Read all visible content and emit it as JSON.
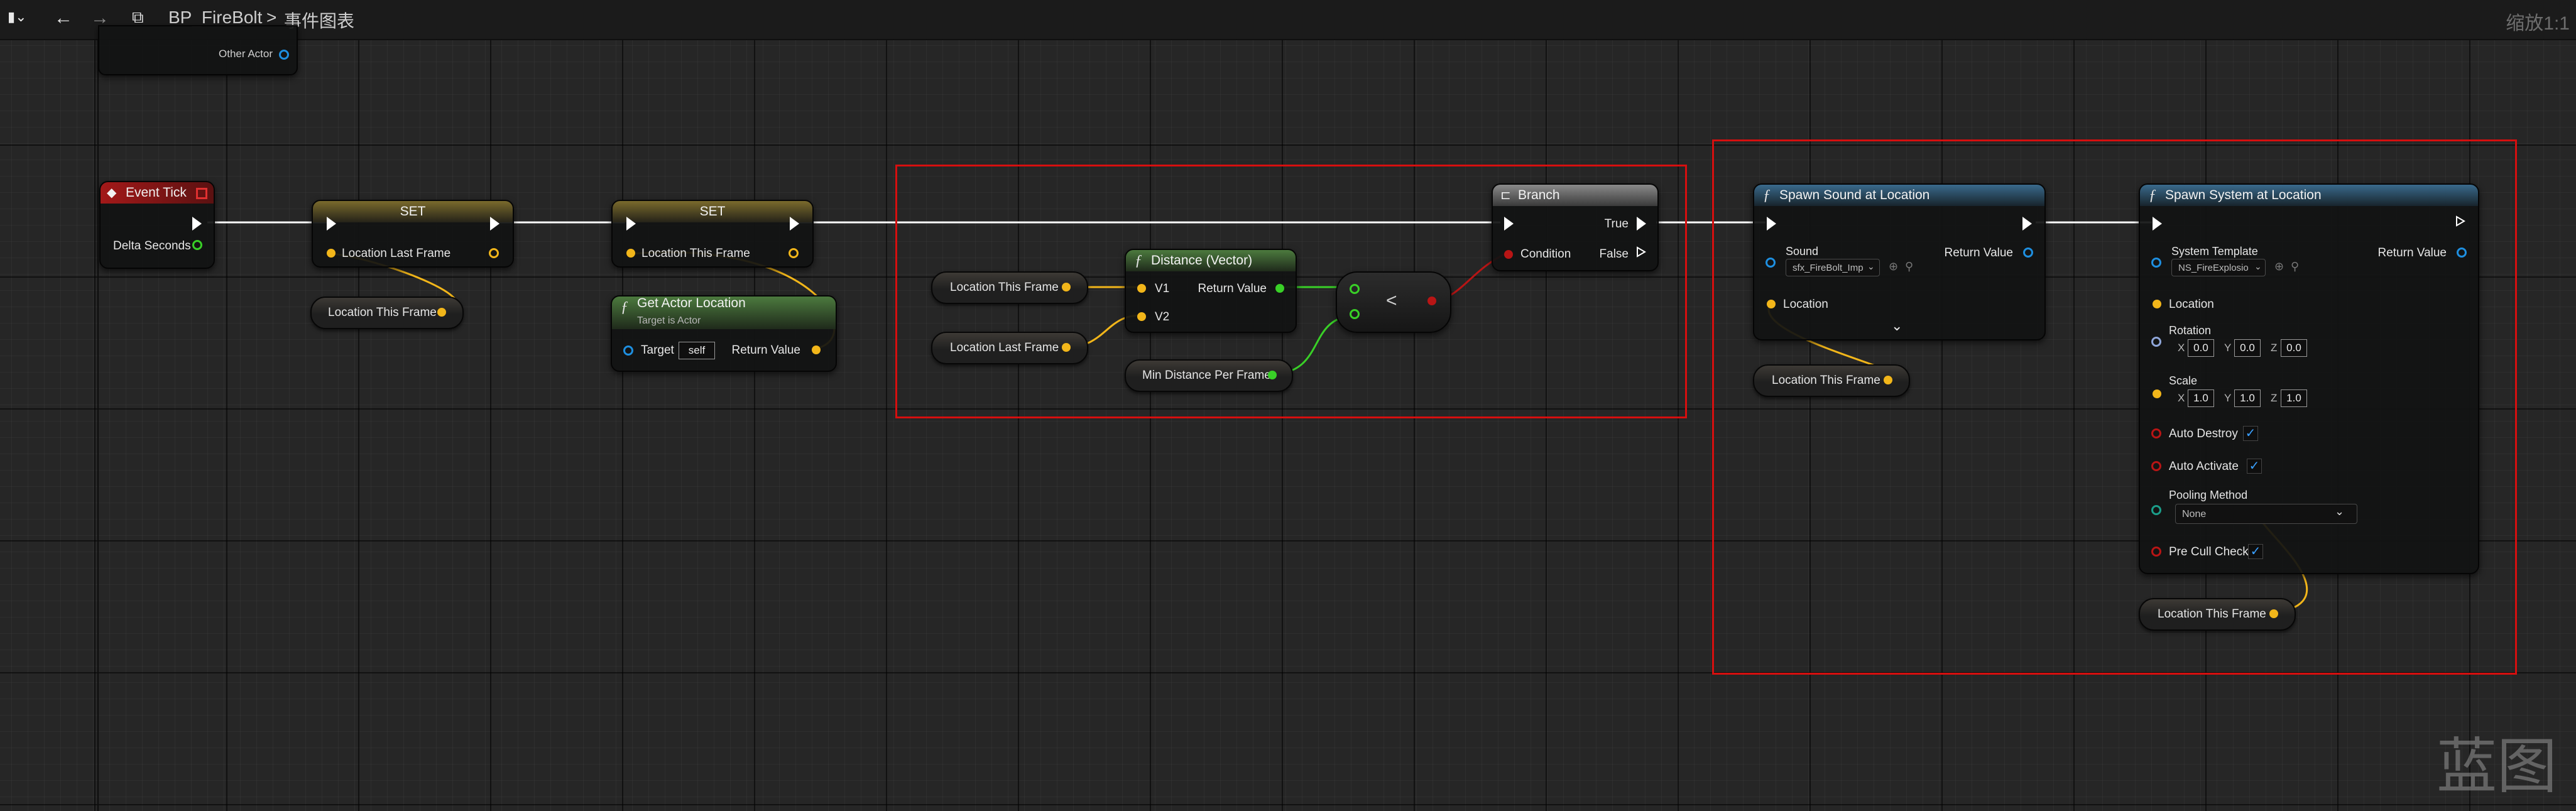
{
  "toolbar": {
    "breadcrumb_blueprint": "BP_FireBolt",
    "breadcrumb_sep": ">",
    "breadcrumb_graph": "事件图表",
    "zoom": "缩放1:1"
  },
  "nodes": {
    "partial": {
      "other_actor": "Other Actor"
    },
    "event_tick": {
      "title": "Event Tick",
      "delta_seconds": "Delta Seconds"
    },
    "set1": {
      "title": "SET",
      "var": "Location Last Frame"
    },
    "set2": {
      "title": "SET",
      "var": "Location This Frame"
    },
    "get_loc1": {
      "label": "Location This Frame"
    },
    "get_actor_location": {
      "title": "Get Actor Location",
      "subtitle": "Target is Actor",
      "target": "Target",
      "target_value": "self",
      "return_value": "Return Value"
    },
    "get_loc2": {
      "label": "Location This Frame"
    },
    "get_loc3": {
      "label": "Location Last Frame"
    },
    "distance": {
      "title": "Distance (Vector)",
      "v1": "V1",
      "v2": "V2",
      "return_value": "Return Value"
    },
    "min_distance": {
      "label": "Min Distance Per Frame"
    },
    "compare": {
      "op": "<"
    },
    "branch": {
      "title": "Branch",
      "condition": "Condition",
      "true": "True",
      "false": "False"
    },
    "spawn_sound": {
      "title": "Spawn Sound at Location",
      "sound": "Sound",
      "sound_value": "sfx_FireBolt_Imp",
      "return_value": "Return Value",
      "location": "Location"
    },
    "get_loc4": {
      "label": "Location This Frame"
    },
    "spawn_system": {
      "title": "Spawn System at Location",
      "system_template": "System Template",
      "system_value": "NS_FireExplosio",
      "return_value": "Return Value",
      "location": "Location",
      "rotation": "Rotation",
      "rot_x": "0.0",
      "rot_y": "0.0",
      "rot_z": "0.0",
      "scale": "Scale",
      "scale_x": "1.0",
      "scale_y": "1.0",
      "scale_z": "1.0",
      "x": "X",
      "y": "Y",
      "z": "Z",
      "auto_destroy": "Auto Destroy",
      "auto_activate": "Auto Activate",
      "pooling_method": "Pooling Method",
      "pooling_value": "None",
      "pre_cull_check": "Pre Cull Check"
    },
    "get_loc5": {
      "label": "Location This Frame"
    }
  },
  "watermark": "蓝图",
  "colors": {
    "exec": "#ffffff",
    "vector": "#f2b61a",
    "float": "#39d027",
    "bool": "#b81515",
    "object": "#1e8fe0",
    "highlight": "#d60f0f"
  }
}
